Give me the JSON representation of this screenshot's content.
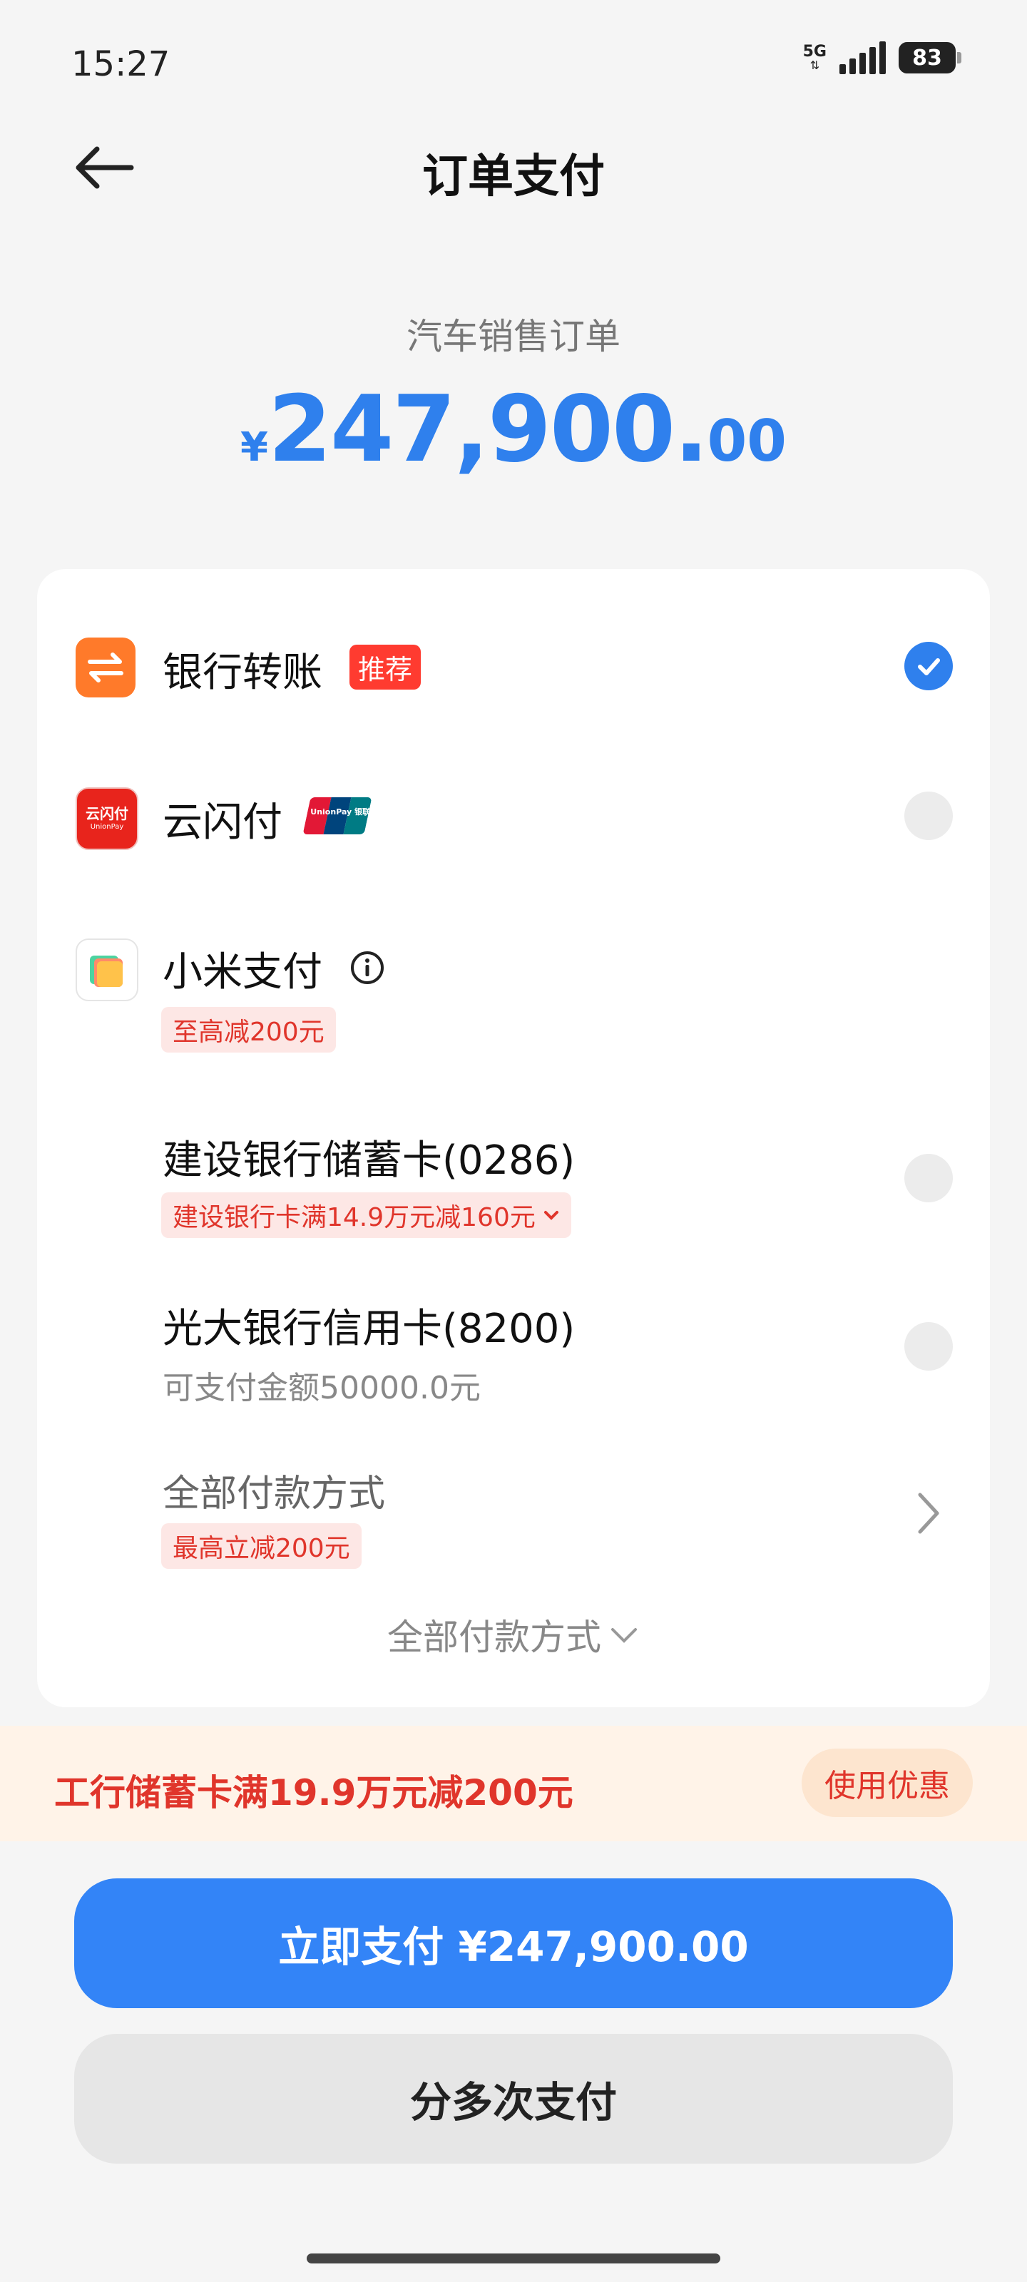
{
  "status_bar": {
    "time": "15:27",
    "network": "5G",
    "battery": "83"
  },
  "header": {
    "title": "订单支付"
  },
  "order": {
    "subtitle": "汽车销售订单",
    "currency": "¥",
    "amount_int": "247,900.",
    "amount_dec": "00"
  },
  "methods": {
    "bank_transfer": {
      "label": "银行转账",
      "badge": "推荐",
      "selected": true
    },
    "cloud_pay": {
      "label": "云闪付",
      "icon_text": "云闪付",
      "icon_sub": "UnionPay",
      "unionpay_logo": "UnionPay 银联"
    },
    "mi_pay": {
      "label": "小米支付",
      "promo": "至高减200元"
    },
    "ccb_card": {
      "label": "建设银行储蓄卡(0286)",
      "promo": "建设银行卡满14.9万元减160元"
    },
    "ceb_card": {
      "label": "光大银行信用卡(8200)",
      "sub": "可支付金额50000.0元"
    },
    "all_methods": {
      "label": "全部付款方式",
      "promo": "最高立减200元"
    },
    "expand_label": "全部付款方式"
  },
  "banner": {
    "text": "工行储蓄卡满19.9万元减200元",
    "button": "使用优惠"
  },
  "actions": {
    "pay_now": "立即支付 ¥247,900.00",
    "split_pay": "分多次支付"
  },
  "colors": {
    "accent": "#2f80ed",
    "promo_red": "#e0352b",
    "banner_bg": "#fff3e8"
  }
}
